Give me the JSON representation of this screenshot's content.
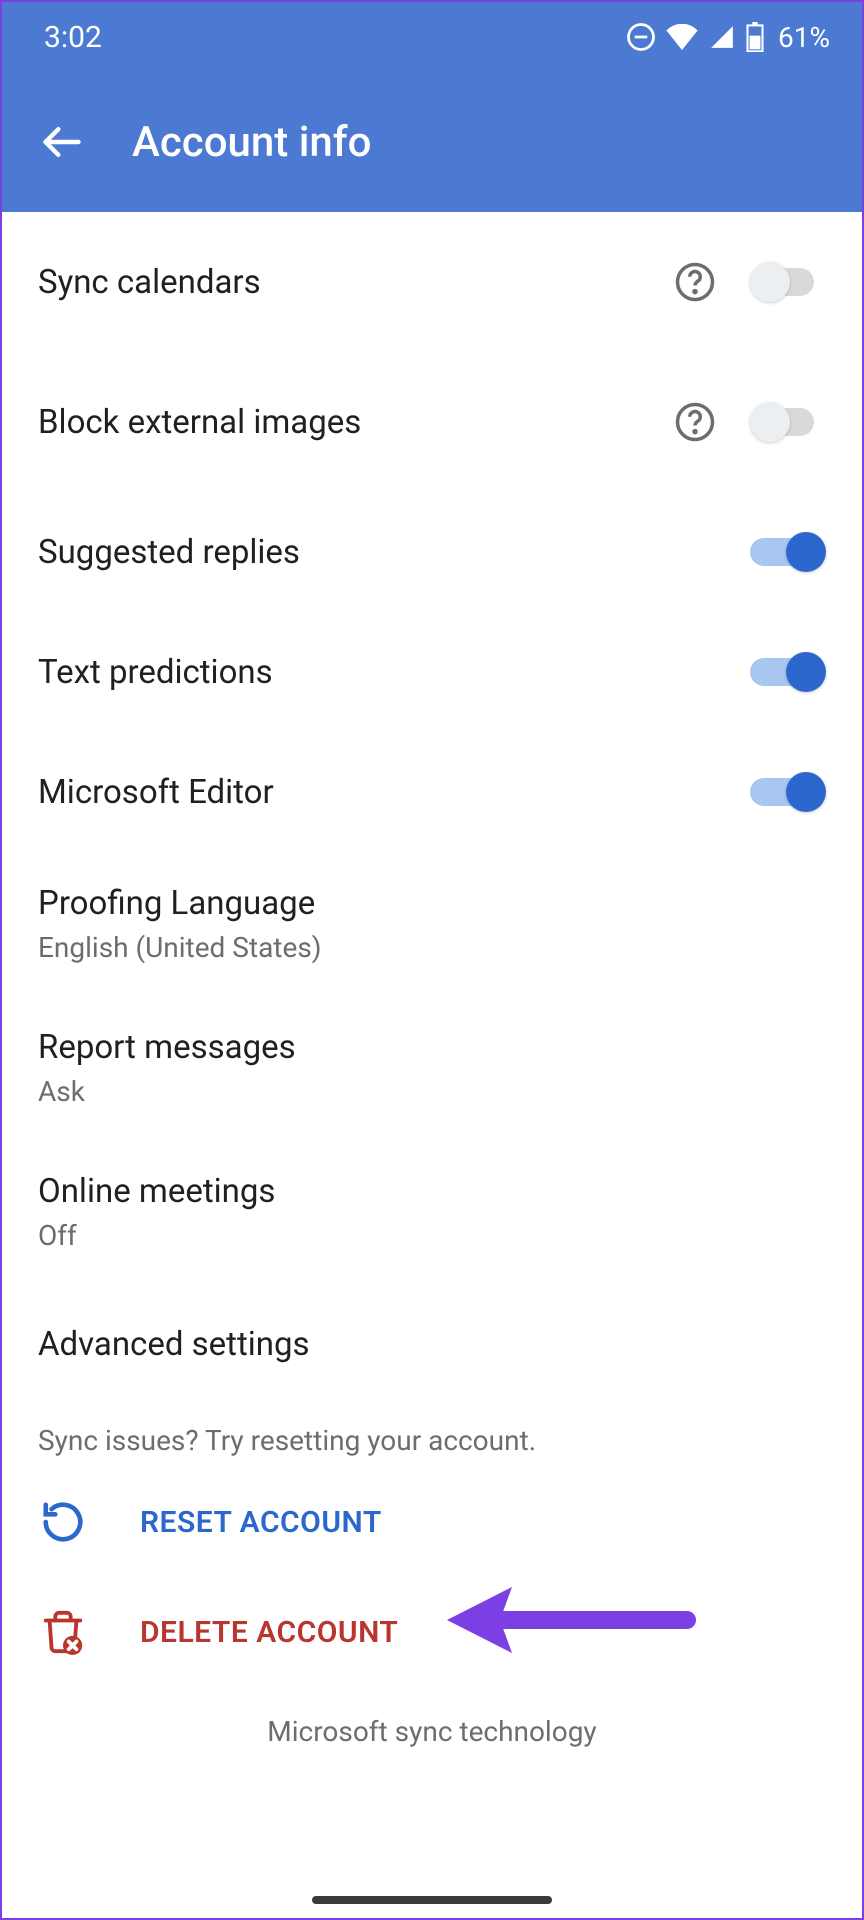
{
  "status": {
    "time": "3:02",
    "battery": "61%"
  },
  "header": {
    "title": "Account info"
  },
  "settings": {
    "sync_calendars": {
      "label": "Sync calendars"
    },
    "block_external_images": {
      "label": "Block external images"
    },
    "suggested_replies": {
      "label": "Suggested replies"
    },
    "text_predictions": {
      "label": "Text predictions"
    },
    "microsoft_editor": {
      "label": "Microsoft Editor"
    },
    "proofing_language": {
      "label": "Proofing Language",
      "value": "English (United States)"
    },
    "report_messages": {
      "label": "Report messages",
      "value": "Ask"
    },
    "online_meetings": {
      "label": "Online meetings",
      "value": "Off"
    },
    "advanced_settings": {
      "label": "Advanced settings"
    }
  },
  "hint": "Sync issues? Try resetting your account.",
  "actions": {
    "reset": "RESET ACCOUNT",
    "delete": "DELETE ACCOUNT"
  },
  "footer": "Microsoft sync technology"
}
